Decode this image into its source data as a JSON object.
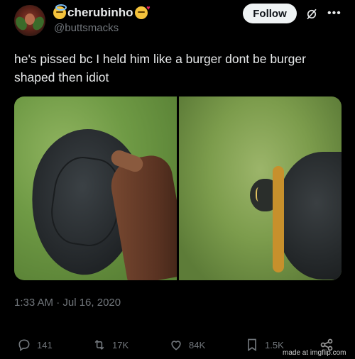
{
  "author": {
    "display_name": "cherubinho",
    "handle": "@buttsmacks",
    "name_emojis": [
      "smiling-face-with-halo",
      "smiling-face-with-hearts"
    ]
  },
  "header": {
    "follow_label": "Follow",
    "icons": [
      "slash-circle-icon",
      "more-icon"
    ]
  },
  "tweet": {
    "text": "he's pissed bc I held him like a burger dont be burger shaped then idiot",
    "timestamp": "1:33 AM · Jul 16, 2020"
  },
  "media": {
    "photos": [
      "turtle-held-in-hand",
      "turtle-on-grass"
    ]
  },
  "actions": {
    "reply_count": "141",
    "retweet_count": "17K",
    "like_count": "84K",
    "bookmark_count": "1.5K"
  },
  "watermark": "made at imgflip.com",
  "colors": {
    "background": "#000000",
    "text_primary": "#e7e9ea",
    "text_secondary": "#71767b",
    "follow_bg": "#eff3f4"
  }
}
